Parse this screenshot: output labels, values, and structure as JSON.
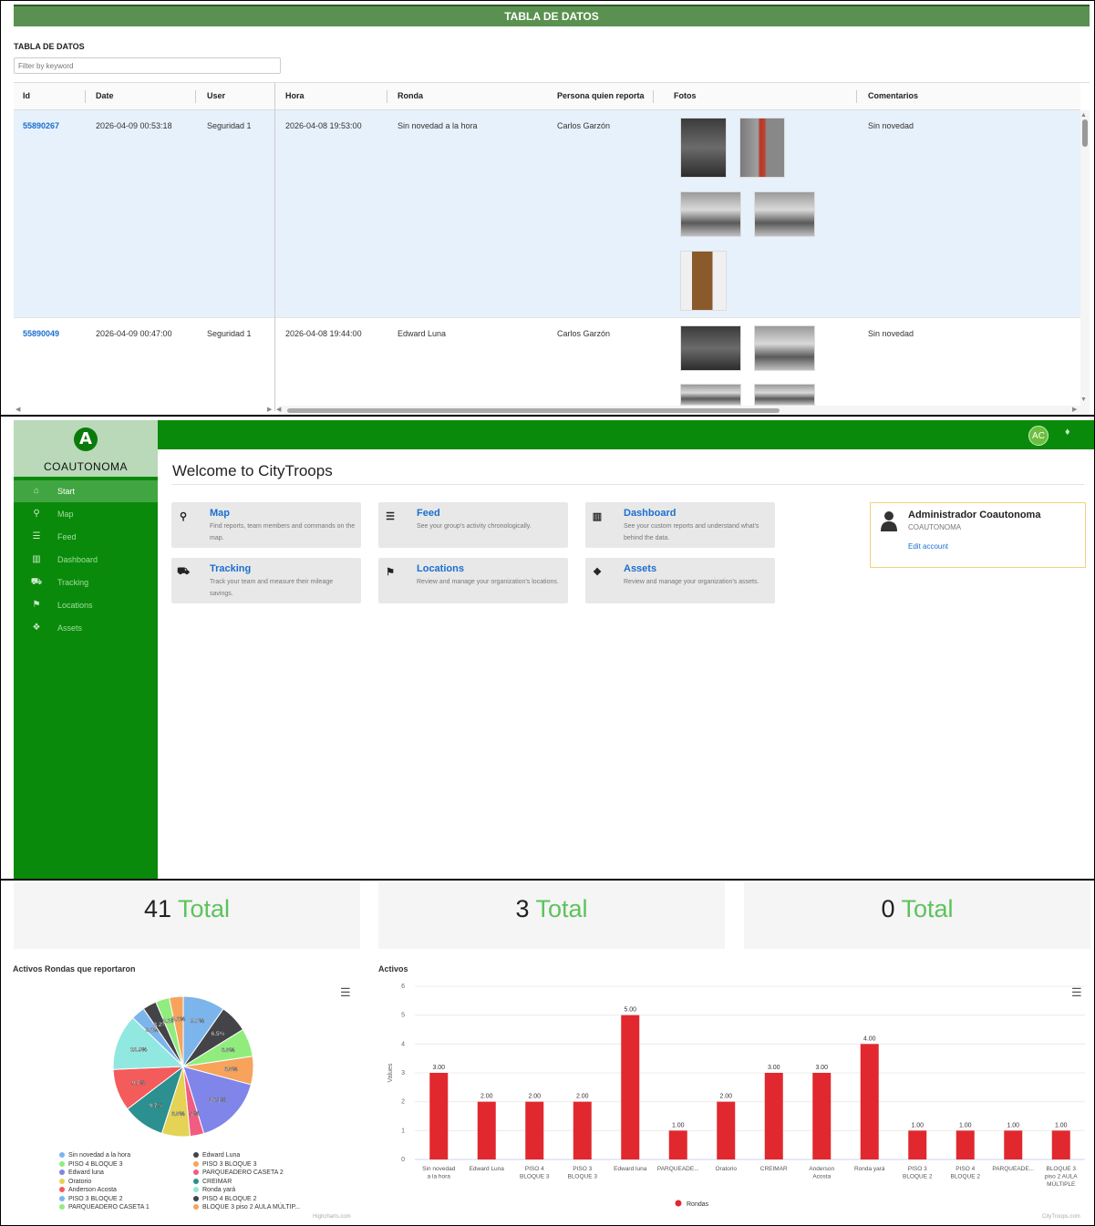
{
  "table_page": {
    "banner_title": "TABLA DE DATOS",
    "section_title": "TABLA DE DATOS",
    "filter_placeholder": "Filter by keyword",
    "columns": [
      "Id",
      "Date",
      "User",
      "Hora",
      "Ronda",
      "Persona quien reporta",
      "Fotos",
      "Comentarios"
    ],
    "rows": [
      {
        "id": "55890267",
        "date": "2026-04-09 00:53:18",
        "user": "Seguridad 1",
        "hora": "2026-04-08 19:53:00",
        "ronda": "Sin novedad a la hora",
        "persona": "Carlos Garzón",
        "comentarios": "Sin novedad"
      },
      {
        "id": "55890049",
        "date": "2026-04-09 00:47:00",
        "user": "Seguridad 1",
        "hora": "2026-04-08 19:44:00",
        "ronda": "Edward Luna",
        "persona": "Carlos Garzón",
        "comentarios": "Sin novedad"
      }
    ]
  },
  "app": {
    "logo_letter": "A",
    "logo_text": "COAUTONOMA",
    "avatar_initials": "AC",
    "nav": [
      {
        "label": "Start",
        "icon": "home-icon",
        "glyph": "⌂",
        "active": true
      },
      {
        "label": "Map",
        "icon": "map-pin-icon",
        "glyph": "⚲",
        "active": false
      },
      {
        "label": "Feed",
        "icon": "list-icon",
        "glyph": "☰",
        "active": false
      },
      {
        "label": "Dashboard",
        "icon": "bar-chart-icon",
        "glyph": "▥",
        "active": false
      },
      {
        "label": "Tracking",
        "icon": "car-icon",
        "glyph": "⛟",
        "active": false
      },
      {
        "label": "Locations",
        "icon": "flag-icon",
        "glyph": "⚑",
        "active": false
      },
      {
        "label": "Assets",
        "icon": "dropbox-icon",
        "glyph": "❖",
        "active": false
      }
    ],
    "welcome": "Welcome to CityTroops",
    "cards": [
      {
        "title": "Map",
        "desc": "Find reports, team members and commands on the map.",
        "icon": "map-pin-icon",
        "glyph": "⚲"
      },
      {
        "title": "Feed",
        "desc": "See your group's activity chronologically.",
        "icon": "list-icon",
        "glyph": "☰"
      },
      {
        "title": "Dashboard",
        "desc": "See your custom reports and understand what's behind the data.",
        "icon": "bar-chart-icon",
        "glyph": "▥"
      },
      {
        "title": "Tracking",
        "desc": "Track your team and measure their mileage savings.",
        "icon": "car-icon",
        "glyph": "⛟"
      },
      {
        "title": "Locations",
        "desc": "Review and manage your organization's locations.",
        "icon": "flag-icon",
        "glyph": "⚑"
      },
      {
        "title": "Assets",
        "desc": "Review and manage your organization's assets.",
        "icon": "dropbox-icon",
        "glyph": "❖"
      }
    ],
    "account": {
      "name": "Administrador Coautonoma",
      "org": "COAUTONOMA",
      "edit": "Edit account"
    }
  },
  "dashboard": {
    "kpis": [
      {
        "number": "41",
        "label": "Total"
      },
      {
        "number": "3",
        "label": "Total"
      },
      {
        "number": "0",
        "label": "Total"
      }
    ],
    "pie_title": "Activos Rondas que reportaron",
    "bar_title": "Activos",
    "pie_credit": "Highcharts.com",
    "bar_credit": "CityTroops.com",
    "colors": {
      "accent_green": "#0a8a0a",
      "bar_red": "#e0282e",
      "total_green": "#5cc35c"
    }
  },
  "chart_data": [
    {
      "type": "pie",
      "title": "Activos Rondas que reportaron",
      "slices": [
        {
          "name": "Sin novedad a la hora",
          "value": 9.7,
          "color": "#7cb5ec"
        },
        {
          "name": "Edward Luna",
          "value": 6.5,
          "color": "#434348"
        },
        {
          "name": "PISO 4 BLOQUE 3",
          "value": 6.5,
          "color": "#90ed7d"
        },
        {
          "name": "PISO 3 BLOQUE 3",
          "value": 6.5,
          "color": "#f7a35c"
        },
        {
          "name": "Edward luna",
          "value": 16.1,
          "color": "#8085e9"
        },
        {
          "name": "PARQUEADERO CASETA 2",
          "value": 3.2,
          "color": "#f15c80"
        },
        {
          "name": "Oratorio",
          "value": 6.5,
          "color": "#e4d354"
        },
        {
          "name": "CREIMAR",
          "value": 9.7,
          "color": "#2b908f"
        },
        {
          "name": "Anderson Acosta",
          "value": 9.7,
          "color": "#f45b5b"
        },
        {
          "name": "Ronda yará",
          "value": 12.9,
          "color": "#91e8e1"
        },
        {
          "name": "PISO 3 BLOQUE 2",
          "value": 3.2,
          "color": "#7cb5ec"
        },
        {
          "name": "PISO 4 BLOQUE 2",
          "value": 3.2,
          "color": "#434348"
        },
        {
          "name": "PARQUEADERO CASETA 1",
          "value": 3.2,
          "color": "#90ed7d"
        },
        {
          "name": "BLOQUE 3 piso 2 AULA MÚLTIP...",
          "value": 3.2,
          "color": "#f7a35c"
        }
      ]
    },
    {
      "type": "bar",
      "title": "Activos",
      "ylabel": "Values",
      "ylim": [
        0,
        6
      ],
      "yticks": [
        0,
        1,
        2,
        3,
        4,
        5,
        6
      ],
      "categories": [
        "Sin novedad a la hora",
        "Edward Luna",
        "PISO 4 BLOQUE 3",
        "PISO 3 BLOQUE 3",
        "Edward luna",
        "PARQUEADE...",
        "Oratorio",
        "CREIMAR",
        "Anderson Acosta",
        "Ronda yará",
        "PISO 3 BLOQUE 2",
        "PISO 4 BLOQUE 2",
        "PARQUEADE...",
        "BLOQUE 3 piso 2 AULA MÚLTIPLE"
      ],
      "series": [
        {
          "name": "Rondas",
          "values": [
            3,
            2,
            2,
            2,
            5,
            1,
            2,
            3,
            3,
            4,
            1,
            1,
            1,
            1
          ],
          "labels": [
            "3.00",
            "2.00",
            "2.00",
            "2.00",
            "5.00",
            "1.00",
            "2.00",
            "3.00",
            "3.00",
            "4.00",
            "1.00",
            "1.00",
            "1.00",
            "1.00"
          ]
        }
      ],
      "legend": "bottom-center"
    }
  ]
}
